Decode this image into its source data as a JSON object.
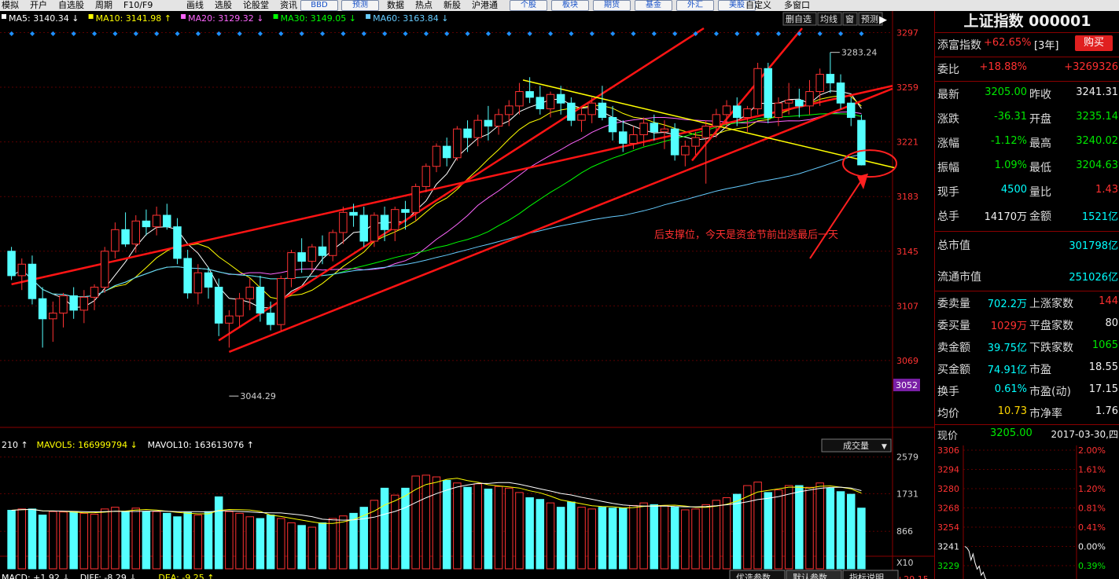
{
  "toolbar": {
    "items": [
      "模拟",
      "开户",
      "自选股",
      "周期",
      "F10/F9",
      "画线",
      "选股",
      "论股堂",
      "资讯"
    ],
    "buttons1": [
      "BBD",
      "预测"
    ],
    "items2": [
      "数据",
      "热点",
      "新股",
      "沪港通"
    ],
    "buttons2": [
      "个股",
      "板块",
      "期货",
      "基金",
      "外汇",
      "美股"
    ],
    "items3": [
      "自定义",
      "多窗口"
    ]
  },
  "chart_tools": [
    "删自选",
    "均线",
    "窗",
    "预测"
  ],
  "ma_legend": [
    {
      "label": "MA5: 3140.34",
      "arrow": "↓",
      "color": "#ffffff"
    },
    {
      "label": "MA10: 3141.98",
      "arrow": "↑",
      "color": "#ffff00"
    },
    {
      "label": "MA20: 3129.32",
      "arrow": "↓",
      "color": "#ff66ff"
    },
    {
      "label": "MA30: 3149.05",
      "arrow": "↓",
      "color": "#00ff00"
    },
    {
      "label": "MA60: 3163.84",
      "arrow": "↓",
      "color": "#66ccff"
    }
  ],
  "vol_legend": [
    {
      "label": "210",
      "arrow": "↑",
      "color": "#ffffff"
    },
    {
      "label": "MAVOL5: 166999794",
      "arrow": "↓",
      "color": "#ffff00"
    },
    {
      "label": "MAVOL10: 163613076",
      "arrow": "↑",
      "color": "#ffffff"
    }
  ],
  "macd_legend": [
    {
      "label": "MACD: +1.92",
      "arrow": "↓",
      "color": "#ffffff"
    },
    {
      "label": "DIFF: -8.29",
      "arrow": "↓",
      "color": "#ffffff"
    },
    {
      "label": "DEA: -9.25",
      "arrow": "↑",
      "color": "#ffff00"
    }
  ],
  "vol_dropdown": "成交量",
  "macd_tabs": [
    "优选参数",
    "默认参数",
    "指标说明"
  ],
  "annotation": "后支撑位，今天是资金节前出逃最后一天",
  "colors": {
    "up": "#ff3232",
    "down": "#54ffff",
    "trend": "#ff1414",
    "yellow_line": "#ffff00",
    "accent_red": "#ff3030",
    "accent_green": "#00e800"
  },
  "chart_data": {
    "type": "candlestick",
    "title": "上证指数 000001",
    "ylim": [
      3040,
      3300
    ],
    "y_ticks": [
      3297,
      3259,
      3221,
      3183,
      3145,
      3107,
      3069
    ],
    "current_tag": "3052",
    "high_label": "3283.24",
    "low_label": "3044.29",
    "candles": [
      [
        3145,
        3148,
        3125,
        3128
      ],
      [
        3128,
        3140,
        3118,
        3136
      ],
      [
        3136,
        3142,
        3108,
        3112
      ],
      [
        3112,
        3120,
        3078,
        3098
      ],
      [
        3098,
        3110,
        3082,
        3102
      ],
      [
        3102,
        3116,
        3092,
        3114
      ],
      [
        3114,
        3120,
        3098,
        3104
      ],
      [
        3104,
        3118,
        3095,
        3113
      ],
      [
        3113,
        3122,
        3104,
        3120
      ],
      [
        3120,
        3148,
        3116,
        3145
      ],
      [
        3145,
        3165,
        3140,
        3160
      ],
      [
        3160,
        3172,
        3148,
        3150
      ],
      [
        3150,
        3170,
        3144,
        3166
      ],
      [
        3166,
        3174,
        3156,
        3162
      ],
      [
        3162,
        3176,
        3156,
        3170
      ],
      [
        3170,
        3178,
        3160,
        3162
      ],
      [
        3162,
        3168,
        3136,
        3140
      ],
      [
        3140,
        3146,
        3112,
        3116
      ],
      [
        3116,
        3136,
        3108,
        3130
      ],
      [
        3130,
        3134,
        3112,
        3120
      ],
      [
        3120,
        3126,
        3086,
        3095
      ],
      [
        3095,
        3104,
        3078,
        3100
      ],
      [
        3100,
        3116,
        3092,
        3112
      ],
      [
        3112,
        3126,
        3104,
        3120
      ],
      [
        3120,
        3128,
        3096,
        3102
      ],
      [
        3102,
        3110,
        3090,
        3094
      ],
      [
        3094,
        3128,
        3090,
        3126
      ],
      [
        3126,
        3146,
        3120,
        3144
      ],
      [
        3144,
        3154,
        3130,
        3138
      ],
      [
        3138,
        3150,
        3130,
        3148
      ],
      [
        3148,
        3156,
        3136,
        3142
      ],
      [
        3142,
        3160,
        3138,
        3158
      ],
      [
        3158,
        3176,
        3150,
        3172
      ],
      [
        3172,
        3178,
        3162,
        3170
      ],
      [
        3170,
        3176,
        3148,
        3152
      ],
      [
        3152,
        3172,
        3148,
        3170
      ],
      [
        3170,
        3176,
        3152,
        3160
      ],
      [
        3160,
        3176,
        3152,
        3174
      ],
      [
        3174,
        3180,
        3160,
        3172
      ],
      [
        3172,
        3192,
        3166,
        3190
      ],
      [
        3190,
        3206,
        3186,
        3204
      ],
      [
        3204,
        3220,
        3200,
        3218
      ],
      [
        3218,
        3224,
        3204,
        3210
      ],
      [
        3210,
        3232,
        3208,
        3230
      ],
      [
        3230,
        3236,
        3214,
        3224
      ],
      [
        3224,
        3240,
        3218,
        3236
      ],
      [
        3236,
        3246,
        3222,
        3232
      ],
      [
        3232,
        3244,
        3226,
        3240
      ],
      [
        3240,
        3250,
        3232,
        3246
      ],
      [
        3246,
        3262,
        3240,
        3256
      ],
      [
        3256,
        3266,
        3248,
        3252
      ],
      [
        3252,
        3260,
        3240,
        3244
      ],
      [
        3244,
        3256,
        3238,
        3254
      ],
      [
        3254,
        3260,
        3240,
        3248
      ],
      [
        3248,
        3252,
        3232,
        3236
      ],
      [
        3236,
        3244,
        3228,
        3240
      ],
      [
        3240,
        3252,
        3234,
        3248
      ],
      [
        3248,
        3260,
        3236,
        3238
      ],
      [
        3238,
        3246,
        3222,
        3228
      ],
      [
        3228,
        3236,
        3214,
        3220
      ],
      [
        3220,
        3232,
        3216,
        3226
      ],
      [
        3226,
        3238,
        3218,
        3234
      ],
      [
        3234,
        3240,
        3222,
        3228
      ],
      [
        3228,
        3236,
        3216,
        3230
      ],
      [
        3230,
        3234,
        3208,
        3212
      ],
      [
        3212,
        3222,
        3204,
        3218
      ],
      [
        3218,
        3228,
        3212,
        3224
      ],
      [
        3224,
        3236,
        3192,
        3232
      ],
      [
        3232,
        3244,
        3224,
        3240
      ],
      [
        3240,
        3250,
        3230,
        3246
      ],
      [
        3246,
        3252,
        3232,
        3238
      ],
      [
        3238,
        3246,
        3228,
        3244
      ],
      [
        3244,
        3276,
        3240,
        3272
      ],
      [
        3272,
        3276,
        3234,
        3238
      ],
      [
        3238,
        3252,
        3232,
        3248
      ],
      [
        3248,
        3262,
        3240,
        3250
      ],
      [
        3250,
        3258,
        3238,
        3246
      ],
      [
        3246,
        3264,
        3240,
        3256
      ],
      [
        3256,
        3272,
        3246,
        3268
      ],
      [
        3268,
        3283.24,
        3255,
        3262
      ],
      [
        3262,
        3268,
        3244,
        3248
      ],
      [
        3248,
        3252,
        3232,
        3238
      ],
      [
        3236,
        3240,
        3204.63,
        3205
      ]
    ],
    "volume_ylim": [
      0,
      2900
    ],
    "volume_ticks": [
      "2579",
      "1731",
      "866"
    ],
    "volume_unit": "X10",
    "volumes": [
      1350,
      1380,
      1380,
      1240,
      1320,
      1310,
      1300,
      1280,
      1260,
      1380,
      1420,
      1320,
      1400,
      1320,
      1320,
      1280,
      1200,
      1300,
      1240,
      1320,
      1660,
      1320,
      1280,
      1200,
      1160,
      1240,
      1160,
      1060,
      1000,
      960,
      1060,
      1160,
      1220,
      1280,
      1420,
      1580,
      1860,
      1700,
      1860,
      2140,
      2160,
      2120,
      2040,
      1980,
      1880,
      1960,
      1840,
      1900,
      1860,
      1760,
      1640,
      1600,
      1520,
      1420,
      1540,
      1420,
      1380,
      1420,
      1400,
      1400,
      1460,
      1520,
      1480,
      1460,
      1420,
      1360,
      1380,
      1480,
      1580,
      1640,
      1720,
      1920,
      2000,
      1760,
      1820,
      1920,
      1920,
      1880,
      1980,
      1860,
      1780,
      1720,
      1400
    ]
  },
  "index": {
    "title": "上证指数 000001"
  },
  "panel": {
    "fortune": {
      "label": "添富指数",
      "value": "+62.65%",
      "suffix": "[3年]",
      "button": "购买"
    },
    "ratio": {
      "label": "委比",
      "value": "+18.88%",
      "diff": "+3269326"
    },
    "quotes": [
      {
        "l1": "最新",
        "v1": "3205.00",
        "c1": "green",
        "l2": "昨收",
        "v2": "3241.31",
        "c2": "white"
      },
      {
        "l1": "涨跌",
        "v1": "-36.31",
        "c1": "green",
        "l2": "开盘",
        "v2": "3235.14",
        "c2": "green"
      },
      {
        "l1": "涨幅",
        "v1": "-1.12%",
        "c1": "green",
        "l2": "最高",
        "v2": "3240.02",
        "c2": "green"
      },
      {
        "l1": "振幅",
        "v1": "1.09%",
        "c1": "green",
        "l2": "最低",
        "v2": "3204.63",
        "c2": "green"
      },
      {
        "l1": "现手",
        "v1": "4500",
        "c1": "cyan",
        "l2": "量比",
        "v2": "1.43",
        "c2": "red"
      },
      {
        "l1": "总手",
        "v1": "14170万",
        "c1": "white",
        "l2": "金额",
        "v2": "1521亿",
        "c2": "cyan"
      }
    ],
    "mcap": {
      "label": "总市值",
      "value": "301798亿"
    },
    "float_mcap": {
      "label": "流通市值",
      "value": "251026亿"
    },
    "stats": [
      {
        "l1": "委卖量",
        "v1": "702.2万",
        "c1": "cyan",
        "l2": "上涨家数",
        "v2": "144",
        "c2": "red"
      },
      {
        "l1": "委买量",
        "v1": "1029万",
        "c1": "red",
        "l2": "平盘家数",
        "v2": "80",
        "c2": "white"
      },
      {
        "l1": "卖金额",
        "v1": "39.75亿",
        "c1": "cyan",
        "l2": "下跌家数",
        "v2": "1065",
        "c2": "green"
      },
      {
        "l1": "买金额",
        "v1": "74.91亿",
        "c1": "cyan",
        "l2": "市盈",
        "v2": "18.55",
        "c2": "white"
      },
      {
        "l1": "换手",
        "v1": "0.61%",
        "c1": "cyan",
        "l2": "市盈(动)",
        "v2": "17.15",
        "c2": "white"
      },
      {
        "l1": "均价",
        "v1": "10.73",
        "c1": "yellow",
        "l2": "市净率",
        "v2": "1.76",
        "c2": "white"
      }
    ],
    "minute": {
      "label": "现价",
      "price": "3205.00",
      "date": "2017-03-30,四",
      "left_ticks": [
        "3306",
        "3294",
        "3280",
        "3268",
        "3254",
        "3241",
        "3229",
        "3215"
      ],
      "right_ticks": [
        "2.00%",
        "1.61%",
        "1.20%",
        "0.81%",
        "0.41%",
        "0.00%",
        "0.39%",
        ""
      ],
      "line": [
        3241,
        3240,
        3238,
        3232,
        3236,
        3230,
        3226,
        3228,
        3222,
        3224,
        3220,
        3218,
        3214,
        3216,
        3212,
        3214,
        3210,
        3208,
        3212,
        3206,
        3208,
        3205
      ]
    }
  }
}
